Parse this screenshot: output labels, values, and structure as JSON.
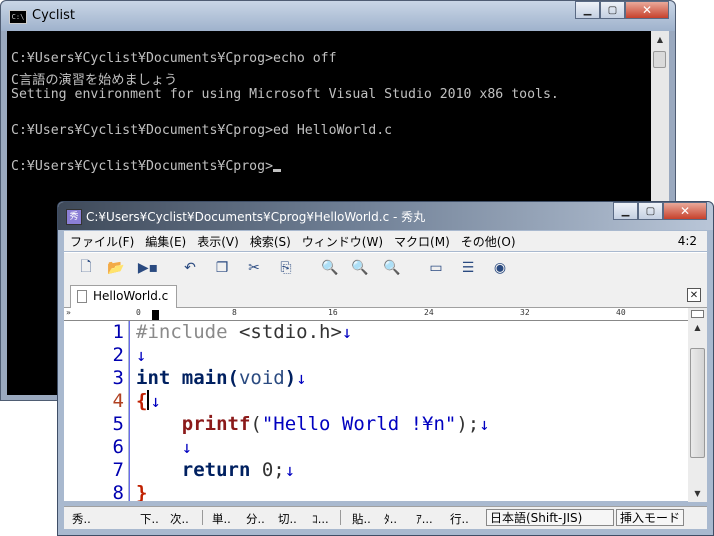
{
  "console": {
    "title": "Cyclist",
    "icon": "C:\\",
    "lines": [
      "",
      "C:¥Users¥Cyclist¥Documents¥Cprog>echo off",
      "C言語の演習を始めましょう",
      "Setting environment for using Microsoft Visual Studio 2010 x86 tools.",
      "",
      "C:¥Users¥Cyclist¥Documents¥Cprog>ed HelloWorld.c",
      "",
      "C:¥Users¥Cyclist¥Documents¥Cprog>"
    ]
  },
  "editor": {
    "title": "C:¥Users¥Cyclist¥Documents¥Cprog¥HelloWorld.c - 秀丸",
    "menu": [
      "ファイル(F)",
      "編集(E)",
      "表示(V)",
      "検索(S)",
      "ウィンドウ(W)",
      "マクロ(M)",
      "その他(O)"
    ],
    "cursor_position": "4:2",
    "tab_label": "HelloWorld.c",
    "ruler": {
      "guide": "»",
      "marks": [
        "0",
        "8",
        "16",
        "24",
        "32",
        "40"
      ]
    },
    "line_numbers": [
      "1",
      "2",
      "3",
      "4",
      "5",
      "6",
      "7",
      "8"
    ],
    "code": {
      "l1_pp": "#include",
      "l1_rest": " <stdio.h>",
      "l3_kw": "int",
      "l3_fn": " main",
      "l3_paren_open": "(",
      "l3_type": "void",
      "l3_paren_close": ")",
      "l4_brace": "{",
      "l5_indent": "    ",
      "l5_fn": "printf",
      "l5_open": "(",
      "l5_str": "\"Hello World !¥n\"",
      "l5_close": ");",
      "l6_indent": "    ",
      "l7_indent": "    ",
      "l7_kw": "return",
      "l7_rest": " 0;",
      "l8_brace": "}",
      "newline_mark": "↓"
    },
    "status": {
      "items": [
        "秀..",
        "下..",
        "次..",
        "単..",
        "分..",
        "切..",
        "ｺ...",
        "貼..",
        "ﾀ..",
        "ｱ...",
        "行.."
      ],
      "encoding": "日本語(Shift-JIS)",
      "mode": "挿入モード"
    }
  }
}
